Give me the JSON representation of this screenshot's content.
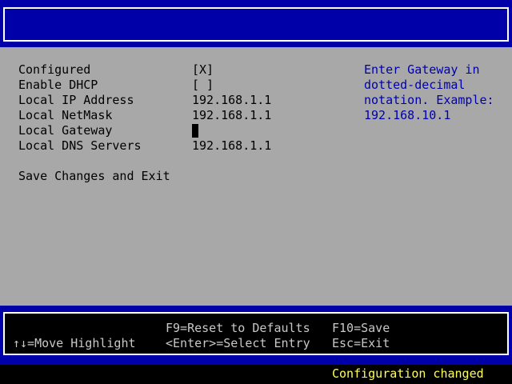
{
  "title": "",
  "settings": [
    {
      "label": "Configured",
      "value": "[X]"
    },
    {
      "label": "Enable DHCP",
      "value": "[ ]"
    },
    {
      "label": "Local IP Address",
      "value": "192.168.1.1"
    },
    {
      "label": "Local NetMask",
      "value": "192.168.1.1"
    },
    {
      "label": "Local Gateway",
      "value": ""
    },
    {
      "label": "Local DNS Servers",
      "value": "192.168.1.1"
    }
  ],
  "save_exit": "Save Changes and Exit",
  "help": {
    "lines": [
      "Enter Gateway in",
      "dotted-decimal",
      "notation. Example:",
      "192.168.10.1"
    ]
  },
  "keys": {
    "move": "↑↓=Move Highlight",
    "reset": "F9=Reset to Defaults",
    "select": "<Enter>=Select Entry",
    "save": "F10=Save",
    "exit": "Esc=Exit"
  },
  "status": "Configuration changed",
  "colors": {
    "band": "#0000a8",
    "main_bg": "#a8a8a8",
    "help_text": "#0000a8",
    "status_text": "#ffff55"
  }
}
